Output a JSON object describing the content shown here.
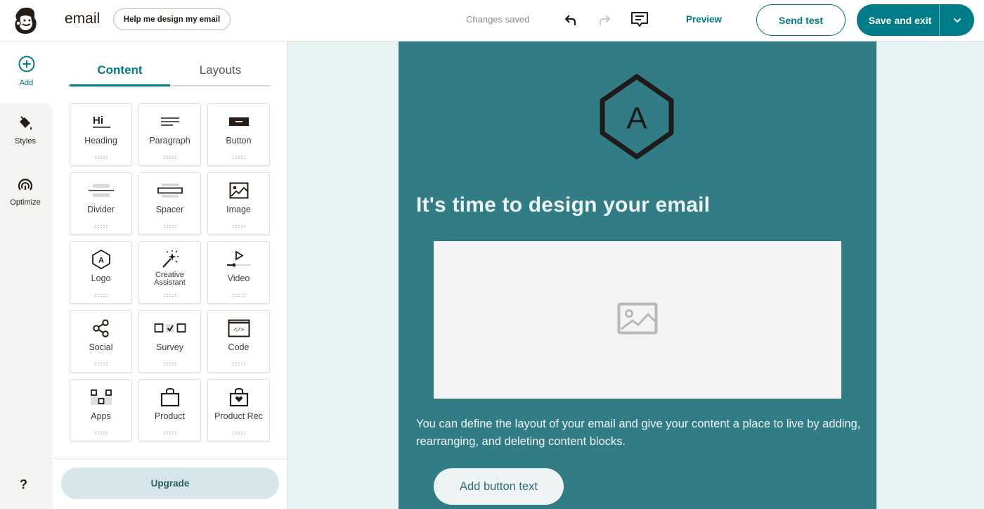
{
  "topbar": {
    "doc_name": "email",
    "help_button": "Help me design my email",
    "status": "Changes saved",
    "undo_icon": "undo-icon",
    "redo_icon": "redo-icon",
    "comments_icon": "comment-icon",
    "preview": "Preview",
    "send_test": "Send test",
    "save_exit": "Save and exit"
  },
  "rail": {
    "items": [
      {
        "label": "Add",
        "icon": "plus-circle-icon",
        "active": true
      },
      {
        "label": "Styles",
        "icon": "paint-bucket-icon"
      },
      {
        "label": "Optimize",
        "icon": "gauge-icon"
      }
    ],
    "help": "?"
  },
  "panel": {
    "tabs": [
      {
        "label": "Content",
        "active": true
      },
      {
        "label": "Layouts",
        "active": false
      }
    ],
    "blocks": [
      {
        "label": "Heading",
        "icon": "heading-icon"
      },
      {
        "label": "Paragraph",
        "icon": "paragraph-icon"
      },
      {
        "label": "Button",
        "icon": "button-icon"
      },
      {
        "label": "Divider",
        "icon": "divider-icon"
      },
      {
        "label": "Spacer",
        "icon": "spacer-icon"
      },
      {
        "label": "Image",
        "icon": "image-icon"
      },
      {
        "label": "Logo",
        "icon": "logo-hexagon-icon"
      },
      {
        "label": "Creative Assistant",
        "icon": "magic-wand-icon"
      },
      {
        "label": "Video",
        "icon": "video-icon"
      },
      {
        "label": "Social",
        "icon": "share-icon"
      },
      {
        "label": "Survey",
        "icon": "survey-icon"
      },
      {
        "label": "Code",
        "icon": "code-icon"
      },
      {
        "label": "Apps",
        "icon": "apps-icon"
      },
      {
        "label": "Product",
        "icon": "shopping-bag-icon"
      },
      {
        "label": "Product Rec",
        "icon": "product-rec-icon"
      }
    ],
    "heading_glyph": "Hi",
    "logo_glyph": "A",
    "code_glyph": "</>",
    "upgrade": "Upgrade"
  },
  "email": {
    "logo_letter": "A",
    "heading": "It's time to design your email",
    "body": "You can define the layout of your email and give your content a place to live by adding, rearranging, and deleting content blocks.",
    "button": "Add button text"
  },
  "colors": {
    "accent": "#007c89",
    "email_bg": "#327c85",
    "canvas_bg": "#e6f2f3",
    "upgrade_bg": "#d6e6ea"
  }
}
